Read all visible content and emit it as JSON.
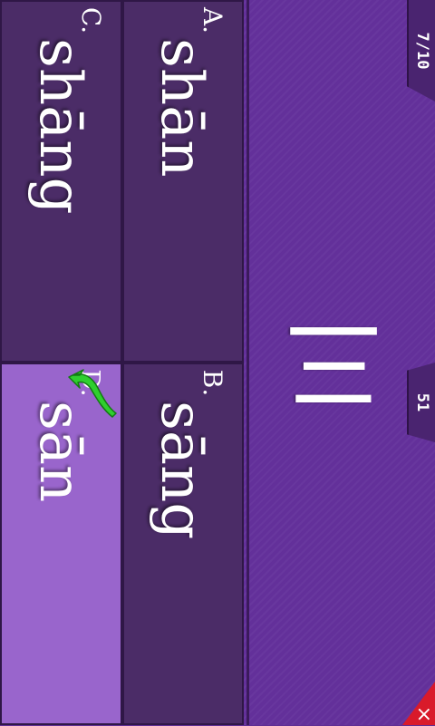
{
  "question": {
    "hanzi": "三"
  },
  "progress": {
    "text": "7/10"
  },
  "score": {
    "text": "51"
  },
  "close": {
    "label": "×"
  },
  "options": [
    {
      "letter": "A.",
      "pinyin": "shān",
      "selected": false
    },
    {
      "letter": "B.",
      "pinyin": "sāng",
      "selected": false
    },
    {
      "letter": "C.",
      "pinyin": "shāng",
      "selected": false
    },
    {
      "letter": "D.",
      "pinyin": "sān",
      "selected": true
    }
  ],
  "colors": {
    "background": "#63309a",
    "option": "#4b2c67",
    "option_selected": "#9965cc",
    "check": "#2fcf2f",
    "close": "#d91a2a"
  },
  "icons": {
    "check": "checkmark-icon",
    "close": "close-icon"
  }
}
